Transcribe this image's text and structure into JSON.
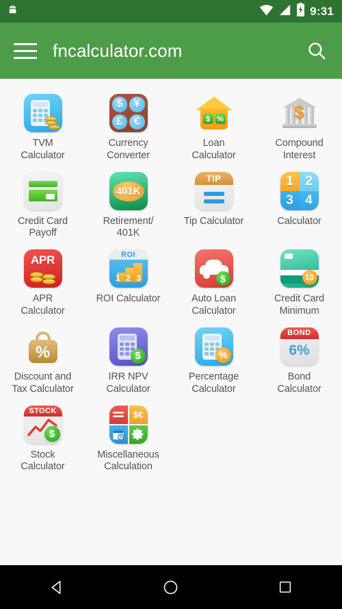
{
  "statusbar": {
    "notification_icon": "android-robot-icon",
    "wifi_icon": "wifi-icon",
    "signal_icon": "cell-signal-icon",
    "battery_icon": "battery-charging-icon",
    "time": "9:31"
  },
  "appbar": {
    "menu_icon": "hamburger-menu-icon",
    "title": "fncalculator.com",
    "search_icon": "search-icon",
    "background_color": "#4c9c48"
  },
  "colors": {
    "status_bar": "#2c7430",
    "app_bar": "#4c9c48",
    "page_background": "#f8f8f8",
    "label_text": "#545454",
    "nav_bar": "#000000"
  },
  "grid": {
    "columns": 4,
    "items": [
      {
        "id": "tvm-calculator",
        "label": "TVM\nCalculator",
        "line1": "TVM",
        "line2": "Calculator"
      },
      {
        "id": "currency-converter",
        "label": "Currency\nConverter",
        "line1": "Currency",
        "line2": "Converter",
        "symbols": [
          "$",
          "¥",
          "£",
          "€"
        ]
      },
      {
        "id": "loan-calculator",
        "label": "Loan\nCalculator",
        "line1": "Loan",
        "line2": "Calculator",
        "badges": [
          "$",
          "%"
        ]
      },
      {
        "id": "compound-interest",
        "label": "Compound\nInterest",
        "line1": "Compound",
        "line2": "Interest",
        "symbol": "$"
      },
      {
        "id": "credit-card-payoff",
        "label": "Credit Card\nPayoff",
        "line1": "Credit Card",
        "line2": "Payoff"
      },
      {
        "id": "retirement-401k",
        "label": "Retirement/\n401K",
        "line1": "Retirement/",
        "line2": "401K",
        "badge_text": "401K"
      },
      {
        "id": "tip-calculator",
        "label": "Tip Calculator",
        "line1": "Tip Calculator",
        "line2": "",
        "header_text": "TIP"
      },
      {
        "id": "calculator",
        "label": "Calculator",
        "line1": "Calculator",
        "line2": "",
        "keys": [
          "1",
          "2",
          "3",
          "4"
        ]
      },
      {
        "id": "apr-calculator",
        "label": "APR\nCalculator",
        "line1": "APR",
        "line2": "Calculator",
        "header_text": "APR"
      },
      {
        "id": "roi-calculator",
        "label": "ROI Calculator",
        "line1": "ROI Calculator",
        "line2": "",
        "header_text": "ROI",
        "bars": [
          "1",
          "2",
          "3"
        ]
      },
      {
        "id": "auto-loan-calculator",
        "label": "Auto Loan\nCalculator",
        "line1": "Auto Loan",
        "line2": "Calculator",
        "badge_text": "$"
      },
      {
        "id": "credit-card-minimum",
        "label": "Credit Card\nMinimum",
        "line1": "Credit Card",
        "line2": "Minimum",
        "badge_text": "10"
      },
      {
        "id": "discount-and-tax-calculator",
        "label": "Discount and\nTax Calculator",
        "line1": "Discount and",
        "line2": "Tax Calculator",
        "symbol": "%"
      },
      {
        "id": "irr-npv-calculator",
        "label": "IRR NPV\nCalculator",
        "line1": "IRR NPV",
        "line2": "Calculator",
        "badge_text": "$"
      },
      {
        "id": "percentage-calculator",
        "label": "Percentage\nCalculator",
        "line1": "Percentage",
        "line2": "Calculator",
        "badge_text": "%"
      },
      {
        "id": "bond-calculator",
        "label": "Bond\nCalculator",
        "line1": "Bond",
        "line2": "Calculator",
        "header_text": "BOND",
        "value_text": "6%"
      },
      {
        "id": "stock-calculator",
        "label": "Stock\nCalculator",
        "line1": "Stock",
        "line2": "Calculator",
        "header_text": "STOCK",
        "badge_text": "$"
      },
      {
        "id": "miscellaneous-calculation",
        "label": "Miscellaneous\nCalculation",
        "line1": "Miscellaneous",
        "line2": "Calculation",
        "quadrants": [
          "=",
          "$€",
          "calendar",
          "gear"
        ]
      }
    ]
  },
  "navbar": {
    "back_icon": "back-triangle-icon",
    "home_icon": "home-circle-icon",
    "recents_icon": "recents-square-icon"
  }
}
